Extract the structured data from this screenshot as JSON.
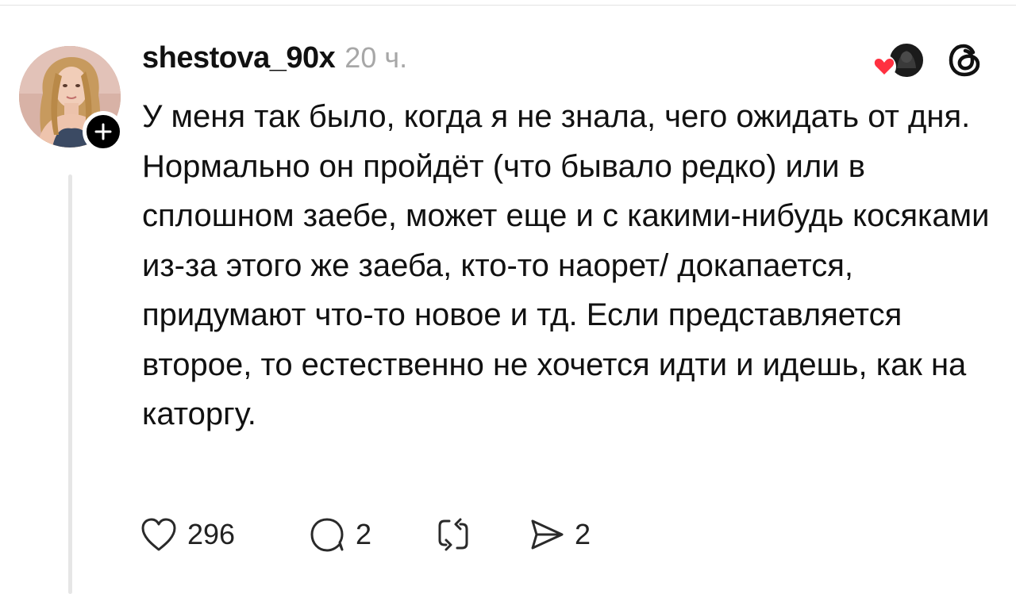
{
  "post": {
    "username": "shestova_90x",
    "timestamp": "20 ч.",
    "text": "У меня так было, когда я не знала, чего ожидать от дня. Нормально он пройдёт (что бывало редко) или в сплошном заебе, может еще и с какими-нибудь косяками из-за этого же заеба, кто-то наорет/ докапается, придумают что-то новое и тд. Если представляется второе, то естественно не хочется идти и идешь, как на каторгу.",
    "actions": {
      "likes": "296",
      "comments": "2",
      "shares": "2"
    }
  },
  "icons": {
    "avatar": "profile-photo",
    "follow": "plus-icon",
    "like": "heart-icon",
    "comment": "speech-bubble-icon",
    "repost": "repost-icon",
    "share": "send-icon",
    "brand": "threads-logo",
    "reply_heart": "heart-icon"
  },
  "colors": {
    "reply_heart": "#ff3040",
    "muted_text": "#a7a7a7"
  }
}
